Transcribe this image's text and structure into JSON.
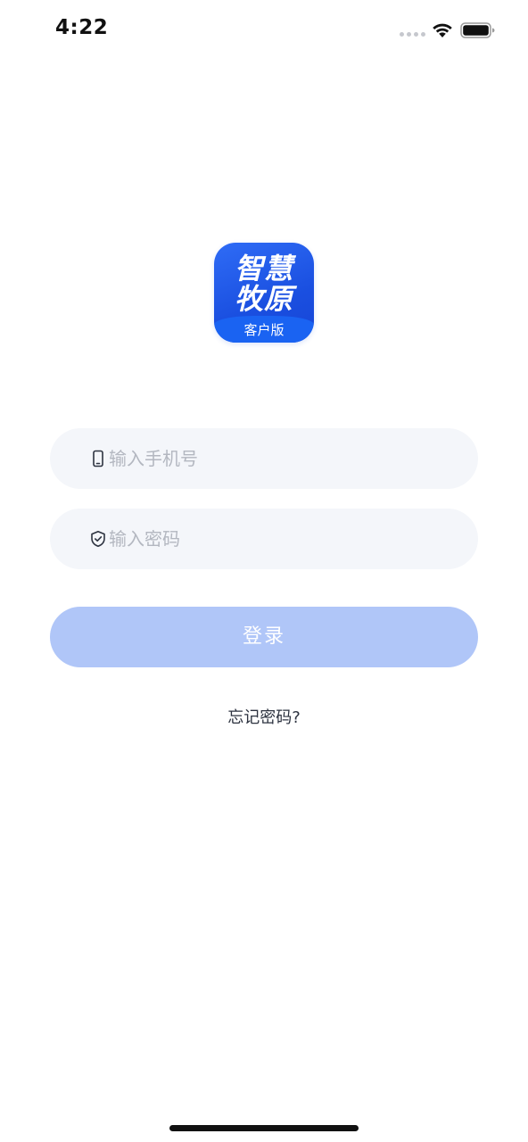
{
  "status_bar": {
    "time": "4:22",
    "icons": [
      "signal-dots-icon",
      "wifi-icon",
      "battery-icon"
    ]
  },
  "logo": {
    "line1": "智慧",
    "line2": "牧原",
    "subtitle": "客户版",
    "colors": {
      "primary": "#1a4fe0",
      "band": "#1a63f2"
    }
  },
  "login_form": {
    "phone": {
      "placeholder": "输入手机号",
      "value": "",
      "icon": "phone-icon"
    },
    "password": {
      "placeholder": "输入密码",
      "value": "",
      "icon": "shield-check-icon"
    },
    "submit_label": "登录",
    "forgot_label": "忘记密码?"
  },
  "colors": {
    "input_bg": "#f4f6fa",
    "button_bg": "#b0c6f8",
    "placeholder": "#b3b7c0"
  }
}
